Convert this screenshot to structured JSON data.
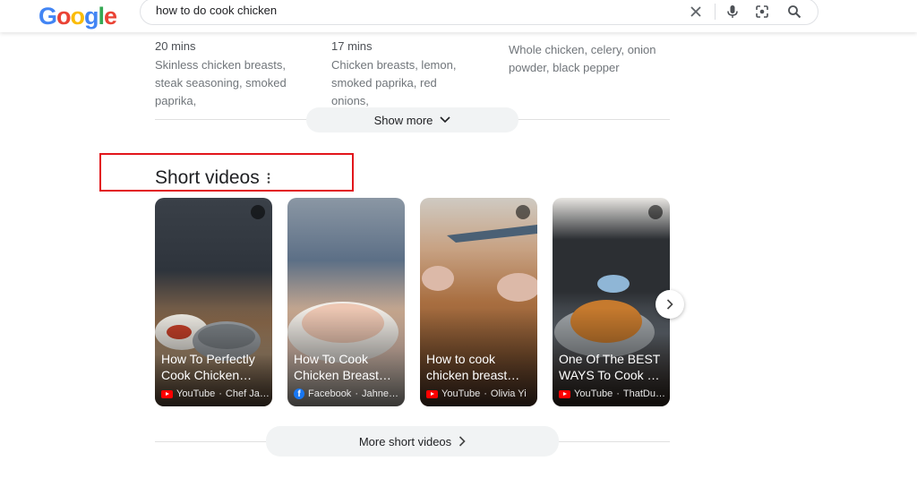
{
  "header": {
    "logo_letters": [
      "G",
      "o",
      "o",
      "g",
      "l",
      "e"
    ],
    "logo_colors": [
      "#4285F4",
      "#EA4335",
      "#FBBC05",
      "#4285F4",
      "#34A853",
      "#EA4335"
    ],
    "search_query": "how to do cook chicken",
    "icons": [
      "clear-icon",
      "microphone-icon",
      "lens-icon",
      "search-icon"
    ]
  },
  "recipes": [
    {
      "time": "20 mins",
      "ingredients": "Skinless chicken breasts, steak seasoning, smoked paprika,"
    },
    {
      "time": "17 mins",
      "ingredients": "Chicken breasts, lemon, smoked paprika, red onions,"
    },
    {
      "time": "",
      "ingredients": "Whole chicken, celery, onion powder, black pepper"
    }
  ],
  "show_more_label": "Show more",
  "short_videos": {
    "title": "Short videos",
    "cards": [
      {
        "title": "How To Perfectly Cook Chicken…",
        "source": "YouTube",
        "author": "Chef Ja…",
        "platform": "youtube",
        "bg": "#6b5a48"
      },
      {
        "title": "How To Cook Chicken Breast…",
        "source": "Facebook",
        "author": "Jahne…",
        "platform": "facebook",
        "bg": "#b9c4cf"
      },
      {
        "title": "How to cook chicken breast…",
        "source": "YouTube",
        "author": "Olivia Yi",
        "platform": "youtube",
        "bg": "#9a6a44"
      },
      {
        "title": "One Of The BEST WAYS To Cook …",
        "source": "YouTube",
        "author": "ThatDu…",
        "platform": "youtube",
        "bg": "#3c3f44"
      }
    ],
    "more_label": "More short videos"
  },
  "accent": "#e2161b"
}
